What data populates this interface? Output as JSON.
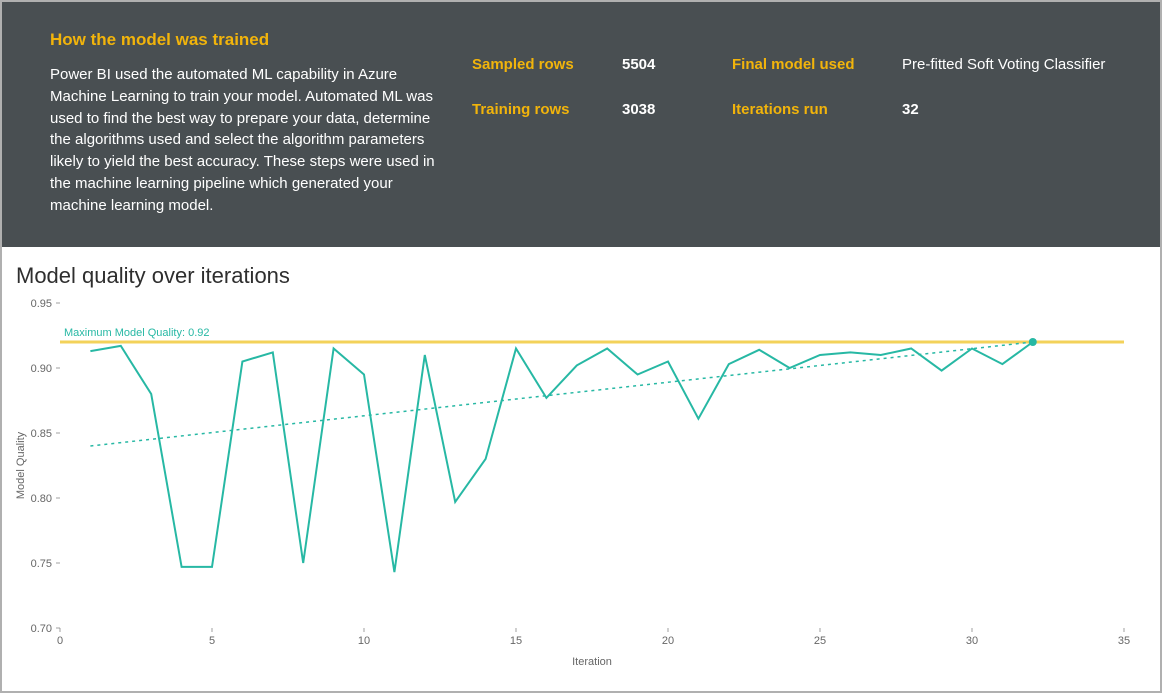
{
  "header": {
    "title": "How the model was trained",
    "body": "Power BI used the automated ML capability in Azure Machine Learning to train your model. Automated ML was used to find the best way to prepare your data, determine the algorithms used and select the algorithm parameters likely to yield the best accuracy. These steps were used in the machine learning pipeline which generated your machine learning model."
  },
  "metrics": {
    "sampled_label": "Sampled rows",
    "sampled_value": "5504",
    "training_label": "Training rows",
    "training_value": "3038",
    "final_model_label": "Final model used",
    "final_model_value": "Pre-fitted Soft Voting Classifier",
    "iterations_label": "Iterations run",
    "iterations_value": "32"
  },
  "chart_title": "Model quality over iterations",
  "chart_data": {
    "type": "line",
    "title": "Model quality over iterations",
    "xlabel": "Iteration",
    "ylabel": "Model Quality",
    "xlim": [
      0,
      35
    ],
    "ylim": [
      0.7,
      0.95
    ],
    "x_ticks": [
      0,
      5,
      10,
      15,
      20,
      25,
      30,
      35
    ],
    "y_ticks": [
      0.7,
      0.75,
      0.8,
      0.85,
      0.9,
      0.95
    ],
    "annotation": "Maximum Model Quality: 0.92",
    "threshold": 0.92,
    "trend": {
      "x1": 1,
      "y1": 0.84,
      "x2": 32,
      "y2": 0.92
    },
    "series": [
      {
        "name": "Model Quality",
        "x": [
          1,
          2,
          3,
          4,
          5,
          6,
          7,
          8,
          9,
          10,
          11,
          12,
          13,
          14,
          15,
          16,
          17,
          18,
          19,
          20,
          21,
          22,
          23,
          24,
          25,
          26,
          27,
          28,
          29,
          30,
          31,
          32
        ],
        "values": [
          0.913,
          0.917,
          0.88,
          0.747,
          0.747,
          0.905,
          0.912,
          0.75,
          0.915,
          0.895,
          0.743,
          0.91,
          0.797,
          0.83,
          0.915,
          0.877,
          0.902,
          0.915,
          0.895,
          0.905,
          0.861,
          0.903,
          0.914,
          0.9,
          0.91,
          0.912,
          0.91,
          0.915,
          0.898,
          0.915,
          0.903,
          0.92
        ]
      }
    ]
  }
}
